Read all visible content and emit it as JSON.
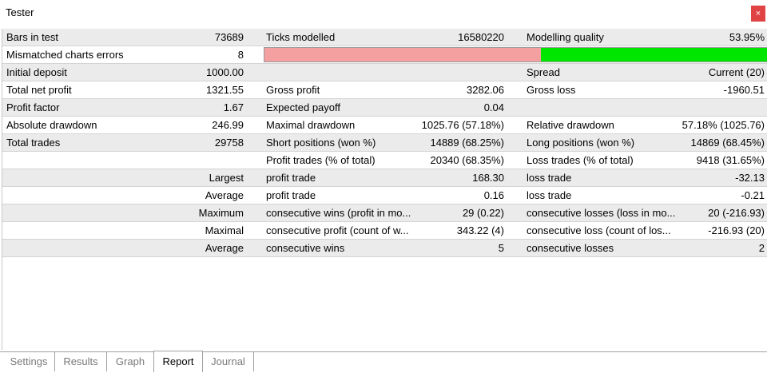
{
  "window": {
    "title": "Tester",
    "close_label": "×"
  },
  "report": {
    "rows": [
      {
        "c1": "Bars in test",
        "v1": "73689",
        "c2": "Ticks modelled",
        "v2": "16580220",
        "c3": "Modelling quality",
        "v3": "53.95%"
      },
      {
        "c1": "Mismatched charts errors",
        "v1": "8"
      },
      {
        "c1": "Initial deposit",
        "v1": "1000.00",
        "c2": "",
        "v2": "",
        "c3": "Spread",
        "v3": "Current (20)"
      },
      {
        "c1": "Total net profit",
        "v1": "1321.55",
        "c2": "Gross profit",
        "v2": "3282.06",
        "c3": "Gross loss",
        "v3": "-1960.51"
      },
      {
        "c1": "Profit factor",
        "v1": "1.67",
        "c2": "Expected payoff",
        "v2": "0.04",
        "c3": "",
        "v3": ""
      },
      {
        "c1": "Absolute drawdown",
        "v1": "246.99",
        "c2": "Maximal drawdown",
        "v2": "1025.76 (57.18%)",
        "c3": "Relative drawdown",
        "v3": "57.18% (1025.76)"
      },
      {
        "c1": "Total trades",
        "v1": "29758",
        "c2": "Short positions (won %)",
        "v2": "14889 (68.25%)",
        "c3": "Long positions (won %)",
        "v3": "14869 (68.45%)"
      },
      {
        "c1": "",
        "v1": "",
        "c2": "Profit trades (% of total)",
        "v2": "20340 (68.35%)",
        "c3": "Loss trades (% of total)",
        "v3": "9418 (31.65%)"
      },
      {
        "c1": "",
        "v1": "Largest",
        "c2": "profit trade",
        "v2": "168.30",
        "c3": "loss trade",
        "v3": "-32.13"
      },
      {
        "c1": "",
        "v1": "Average",
        "c2": "profit trade",
        "v2": "0.16",
        "c3": "loss trade",
        "v3": "-0.21"
      },
      {
        "c1": "",
        "v1": "Maximum",
        "c2": "consecutive wins (profit in mo...",
        "v2": "29 (0.22)",
        "c3": "consecutive losses (loss in mo...",
        "v3": "20 (-216.93)"
      },
      {
        "c1": "",
        "v1": "Maximal",
        "c2": "consecutive profit (count of w...",
        "v2": "343.22 (4)",
        "c3": "consecutive loss (count of los...",
        "v3": "-216.93 (20)"
      },
      {
        "c1": "",
        "v1": "Average",
        "c2": "consecutive wins",
        "v2": "5",
        "c3": "consecutive losses",
        "v3": "2"
      }
    ],
    "quality_bar": {
      "value_fraction": 0.45,
      "colors": {
        "bad": "#f5a0a0",
        "good": "#00e600"
      }
    }
  },
  "tabs": [
    {
      "label": "Settings"
    },
    {
      "label": "Results"
    },
    {
      "label": "Graph"
    },
    {
      "label": "Report",
      "active": true
    },
    {
      "label": "Journal"
    }
  ]
}
